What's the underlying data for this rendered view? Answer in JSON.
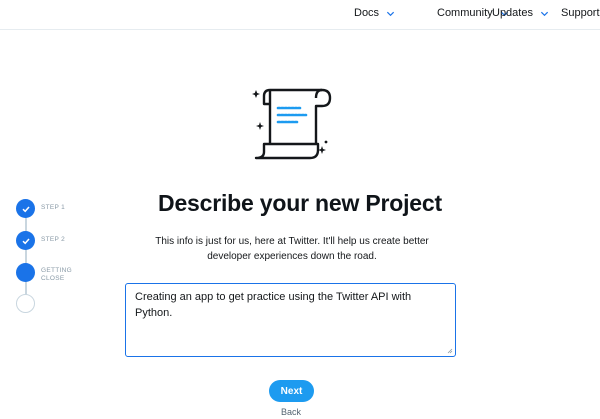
{
  "nav": {
    "items": [
      {
        "label": "Docs",
        "has_dropdown": true,
        "icon": "chevron-down-icon"
      },
      {
        "label": "Community",
        "has_dropdown": true,
        "icon": "chevron-down-icon"
      },
      {
        "label": "Updates",
        "has_dropdown": true,
        "icon": "chevron-down-icon"
      },
      {
        "label": "Support",
        "has_dropdown": false
      }
    ]
  },
  "illustration": {
    "icon": "scroll-document-icon"
  },
  "page": {
    "title": "Describe your new Project",
    "subtitle": "This info is just for us, here at Twitter. It'll help us create better developer experiences down the road."
  },
  "stepper": {
    "steps": [
      {
        "label": "STEP 1",
        "state": "done"
      },
      {
        "label": "STEP 2",
        "state": "done"
      },
      {
        "label": "GETTING CLOSE",
        "state": "current"
      },
      {
        "label": "",
        "state": "todo"
      }
    ]
  },
  "form": {
    "description_value": "Creating an app to get practice using the Twitter API with Python."
  },
  "actions": {
    "next_label": "Next",
    "back_label": "Back"
  },
  "colors": {
    "accent": "#1a73e8",
    "button": "#1d9bf0",
    "muted": "#8899a6"
  }
}
